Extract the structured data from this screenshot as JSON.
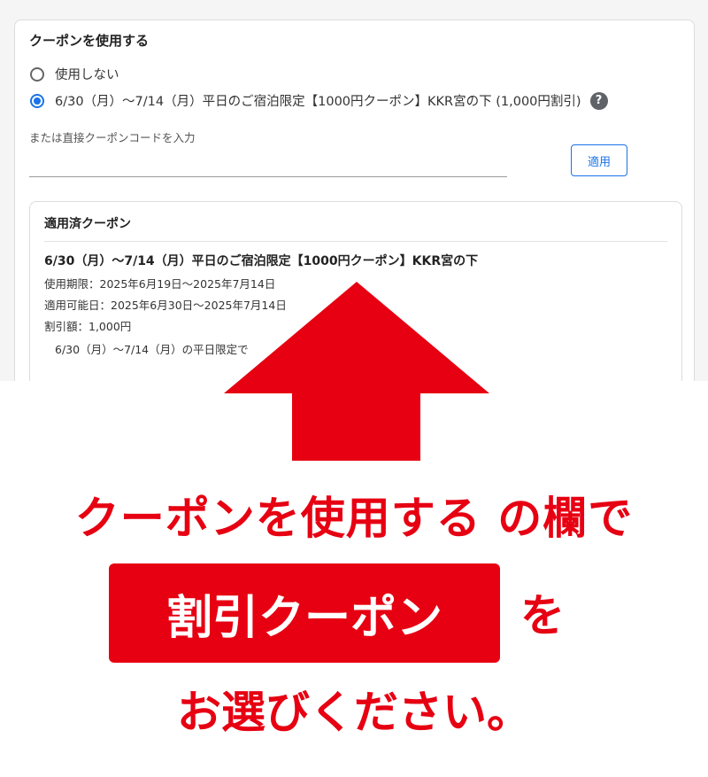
{
  "coupon_section": {
    "title": "クーポンを使用する",
    "options": [
      {
        "label": "使用しない",
        "checked": false
      },
      {
        "label": "6/30（月）〜7/14（月）平日のご宿泊限定【1000円クーポン】KKR宮の下 (1,000円割引)",
        "checked": true
      }
    ],
    "help_icon": "?",
    "code_label": "または直接クーポンコードを入力",
    "code_value": "",
    "apply_label": "適用"
  },
  "applied": {
    "title": "適用済クーポン",
    "name": "6/30（月）〜7/14（月）平日のご宿泊限定【1000円クーポン】KKR宮の下",
    "period": "使用期限：2025年6月19日〜2025年7月14日",
    "available": "適用可能日：2025年6月30日〜2025年7月14日",
    "discount": "割引額：1,000円",
    "description": "6/30（月）〜7/14（月）の平日限定で"
  },
  "overlay": {
    "line1": "クーポンを使用する の欄で",
    "badge": "割引クーポン",
    "line2_suffix": "を",
    "line3": "お選びください。",
    "accent_color": "#e60012"
  }
}
